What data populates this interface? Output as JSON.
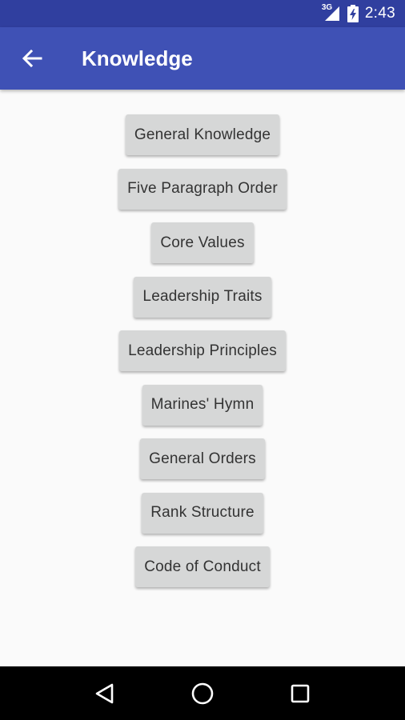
{
  "status_bar": {
    "network_type": "3G",
    "time": "2:43",
    "icons": [
      "signal-icon",
      "battery-charging-icon"
    ]
  },
  "app_bar": {
    "title": "Knowledge",
    "back_icon": "arrow-back-icon"
  },
  "menu": {
    "items": [
      {
        "label": "General Knowledge"
      },
      {
        "label": "Five Paragraph Order"
      },
      {
        "label": "Core Values"
      },
      {
        "label": "Leadership Traits"
      },
      {
        "label": "Leadership Principles"
      },
      {
        "label": "Marines' Hymn"
      },
      {
        "label": "General Orders"
      },
      {
        "label": "Rank Structure"
      },
      {
        "label": "Code of Conduct"
      }
    ]
  },
  "nav_bar": {
    "icons": [
      "back-triangle-icon",
      "home-circle-icon",
      "recents-square-icon"
    ]
  },
  "colors": {
    "status_bar": "#303f9f",
    "app_bar": "#3f51b5",
    "background": "#fafafa",
    "button": "#d6d7d7",
    "button_text": "#333333",
    "nav_bar": "#000000"
  }
}
